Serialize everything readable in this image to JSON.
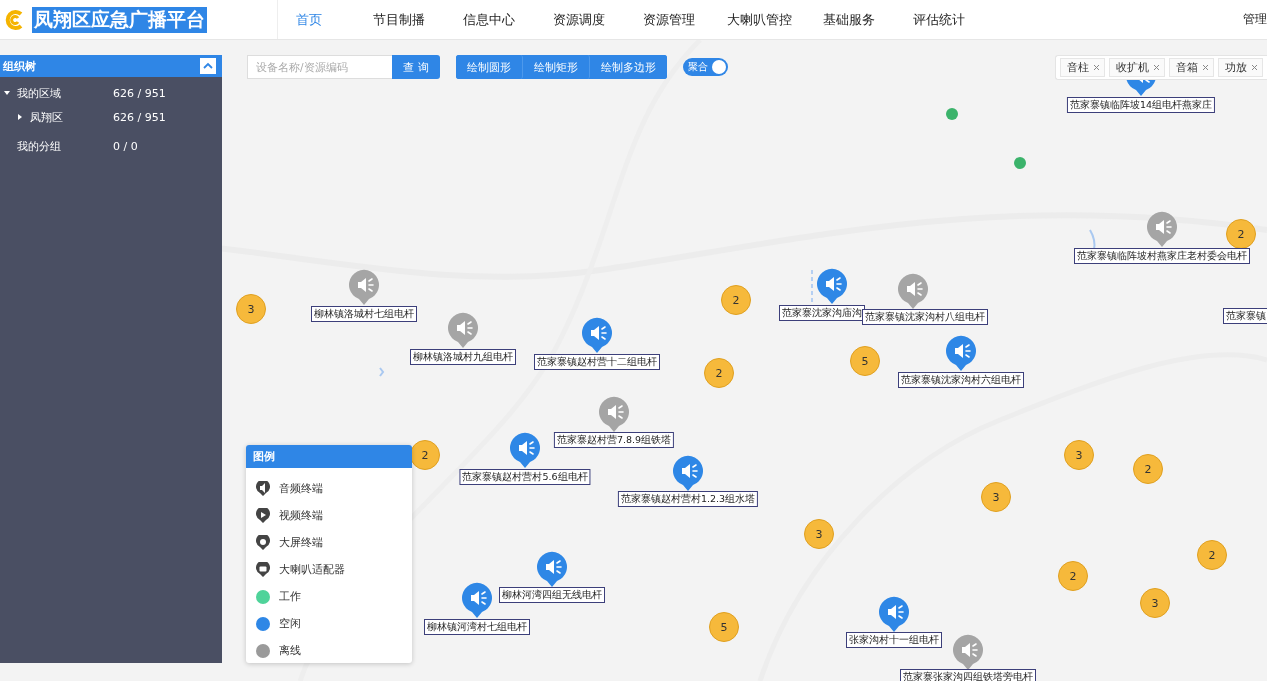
{
  "header": {
    "title": "凤翔区应急广播平台",
    "nav": [
      {
        "label": "首页",
        "selected": true
      },
      {
        "label": "节目制播",
        "selected": false
      },
      {
        "label": "信息中心",
        "selected": false
      },
      {
        "label": "资源调度",
        "selected": false
      },
      {
        "label": "资源管理",
        "selected": false
      },
      {
        "label": "大喇叭管控",
        "selected": false
      },
      {
        "label": "基础服务",
        "selected": false
      },
      {
        "label": "评估统计",
        "selected": false
      }
    ],
    "user": "管理"
  },
  "sidebar": {
    "title": "组织树",
    "tree": [
      {
        "label": "我的区域",
        "count": "626 / 951",
        "expanded": true,
        "children": [
          {
            "label": "凤翔区",
            "count": "626 / 951",
            "expanded": false
          }
        ]
      },
      {
        "label": "我的分组",
        "count": "0 / 0"
      }
    ]
  },
  "toolbar": {
    "search": {
      "placeholder": "设备名称/资源编码"
    },
    "search_button": "查 询",
    "draw_buttons": [
      "绘制圆形",
      "绘制矩形",
      "绘制多边形"
    ],
    "cluster_toggle": {
      "label": "聚合",
      "on": true
    }
  },
  "filter_tags": [
    "音柱",
    "收扩机",
    "音箱",
    "功放"
  ],
  "legend": {
    "title": "图例",
    "items": [
      {
        "kind": "icon",
        "label": "音频终端"
      },
      {
        "kind": "icon",
        "label": "视频终端"
      },
      {
        "kind": "icon",
        "label": "大屏终端"
      },
      {
        "kind": "icon",
        "label": "大喇叭适配器"
      },
      {
        "kind": "dot",
        "color": "#4fd39a",
        "label": "工作"
      },
      {
        "kind": "dot",
        "color": "#2e87e6",
        "label": "空闲"
      },
      {
        "kind": "dot",
        "color": "#9a9a9a",
        "label": "离线"
      }
    ]
  },
  "map": {
    "markers": [
      {
        "kind": "pin",
        "offline": true,
        "label": "柳林镇洛城村七组电杆"
      },
      {
        "kind": "pin",
        "offline": true,
        "label": "柳林镇洛城村九组电杆"
      },
      {
        "kind": "pin",
        "offline": false,
        "label": "范家寨镇赵村营十二组电杆"
      },
      {
        "kind": "pin",
        "offline": true,
        "label": "范家寨赵村营7.8.9组铁塔"
      },
      {
        "kind": "pin",
        "offline": false,
        "label": "范家寨镇赵村营村5.6组电杆"
      },
      {
        "kind": "pin",
        "offline": false,
        "label": "范家寨镇赵村营村1.2.3组水塔"
      },
      {
        "kind": "pin",
        "offline": false,
        "label": "柳林河湾四组无线电杆"
      },
      {
        "kind": "pin",
        "offline": false,
        "label": "柳林镇河湾村七组电杆"
      },
      {
        "kind": "pin",
        "offline": false,
        "label": "范家寨沈家沟庙沟"
      },
      {
        "kind": "pin",
        "offline": true,
        "label": "范家寨镇沈家沟村八组电杆"
      },
      {
        "kind": "pin",
        "offline": false,
        "label": "范家寨镇沈家沟村六组电杆"
      },
      {
        "kind": "pin",
        "offline": false,
        "label": "范家寨镇临阵坡14组电杆燕家庄"
      },
      {
        "kind": "pin",
        "offline": true,
        "label": "范家寨镇临阵坡村燕家庄老村委会电杆"
      },
      {
        "kind": "pin",
        "offline": false,
        "label": "张家沟村十一组电杆"
      },
      {
        "kind": "pin",
        "offline": true,
        "label": "范家寨张家沟四组铁塔旁电杆"
      },
      {
        "kind": "label",
        "label": "范家寨镇"
      }
    ],
    "clusters": [
      "3",
      "2",
      "2",
      "5",
      "2",
      "3",
      "5",
      "3",
      "2",
      "2",
      "2",
      "3",
      "3",
      "2"
    ]
  }
}
